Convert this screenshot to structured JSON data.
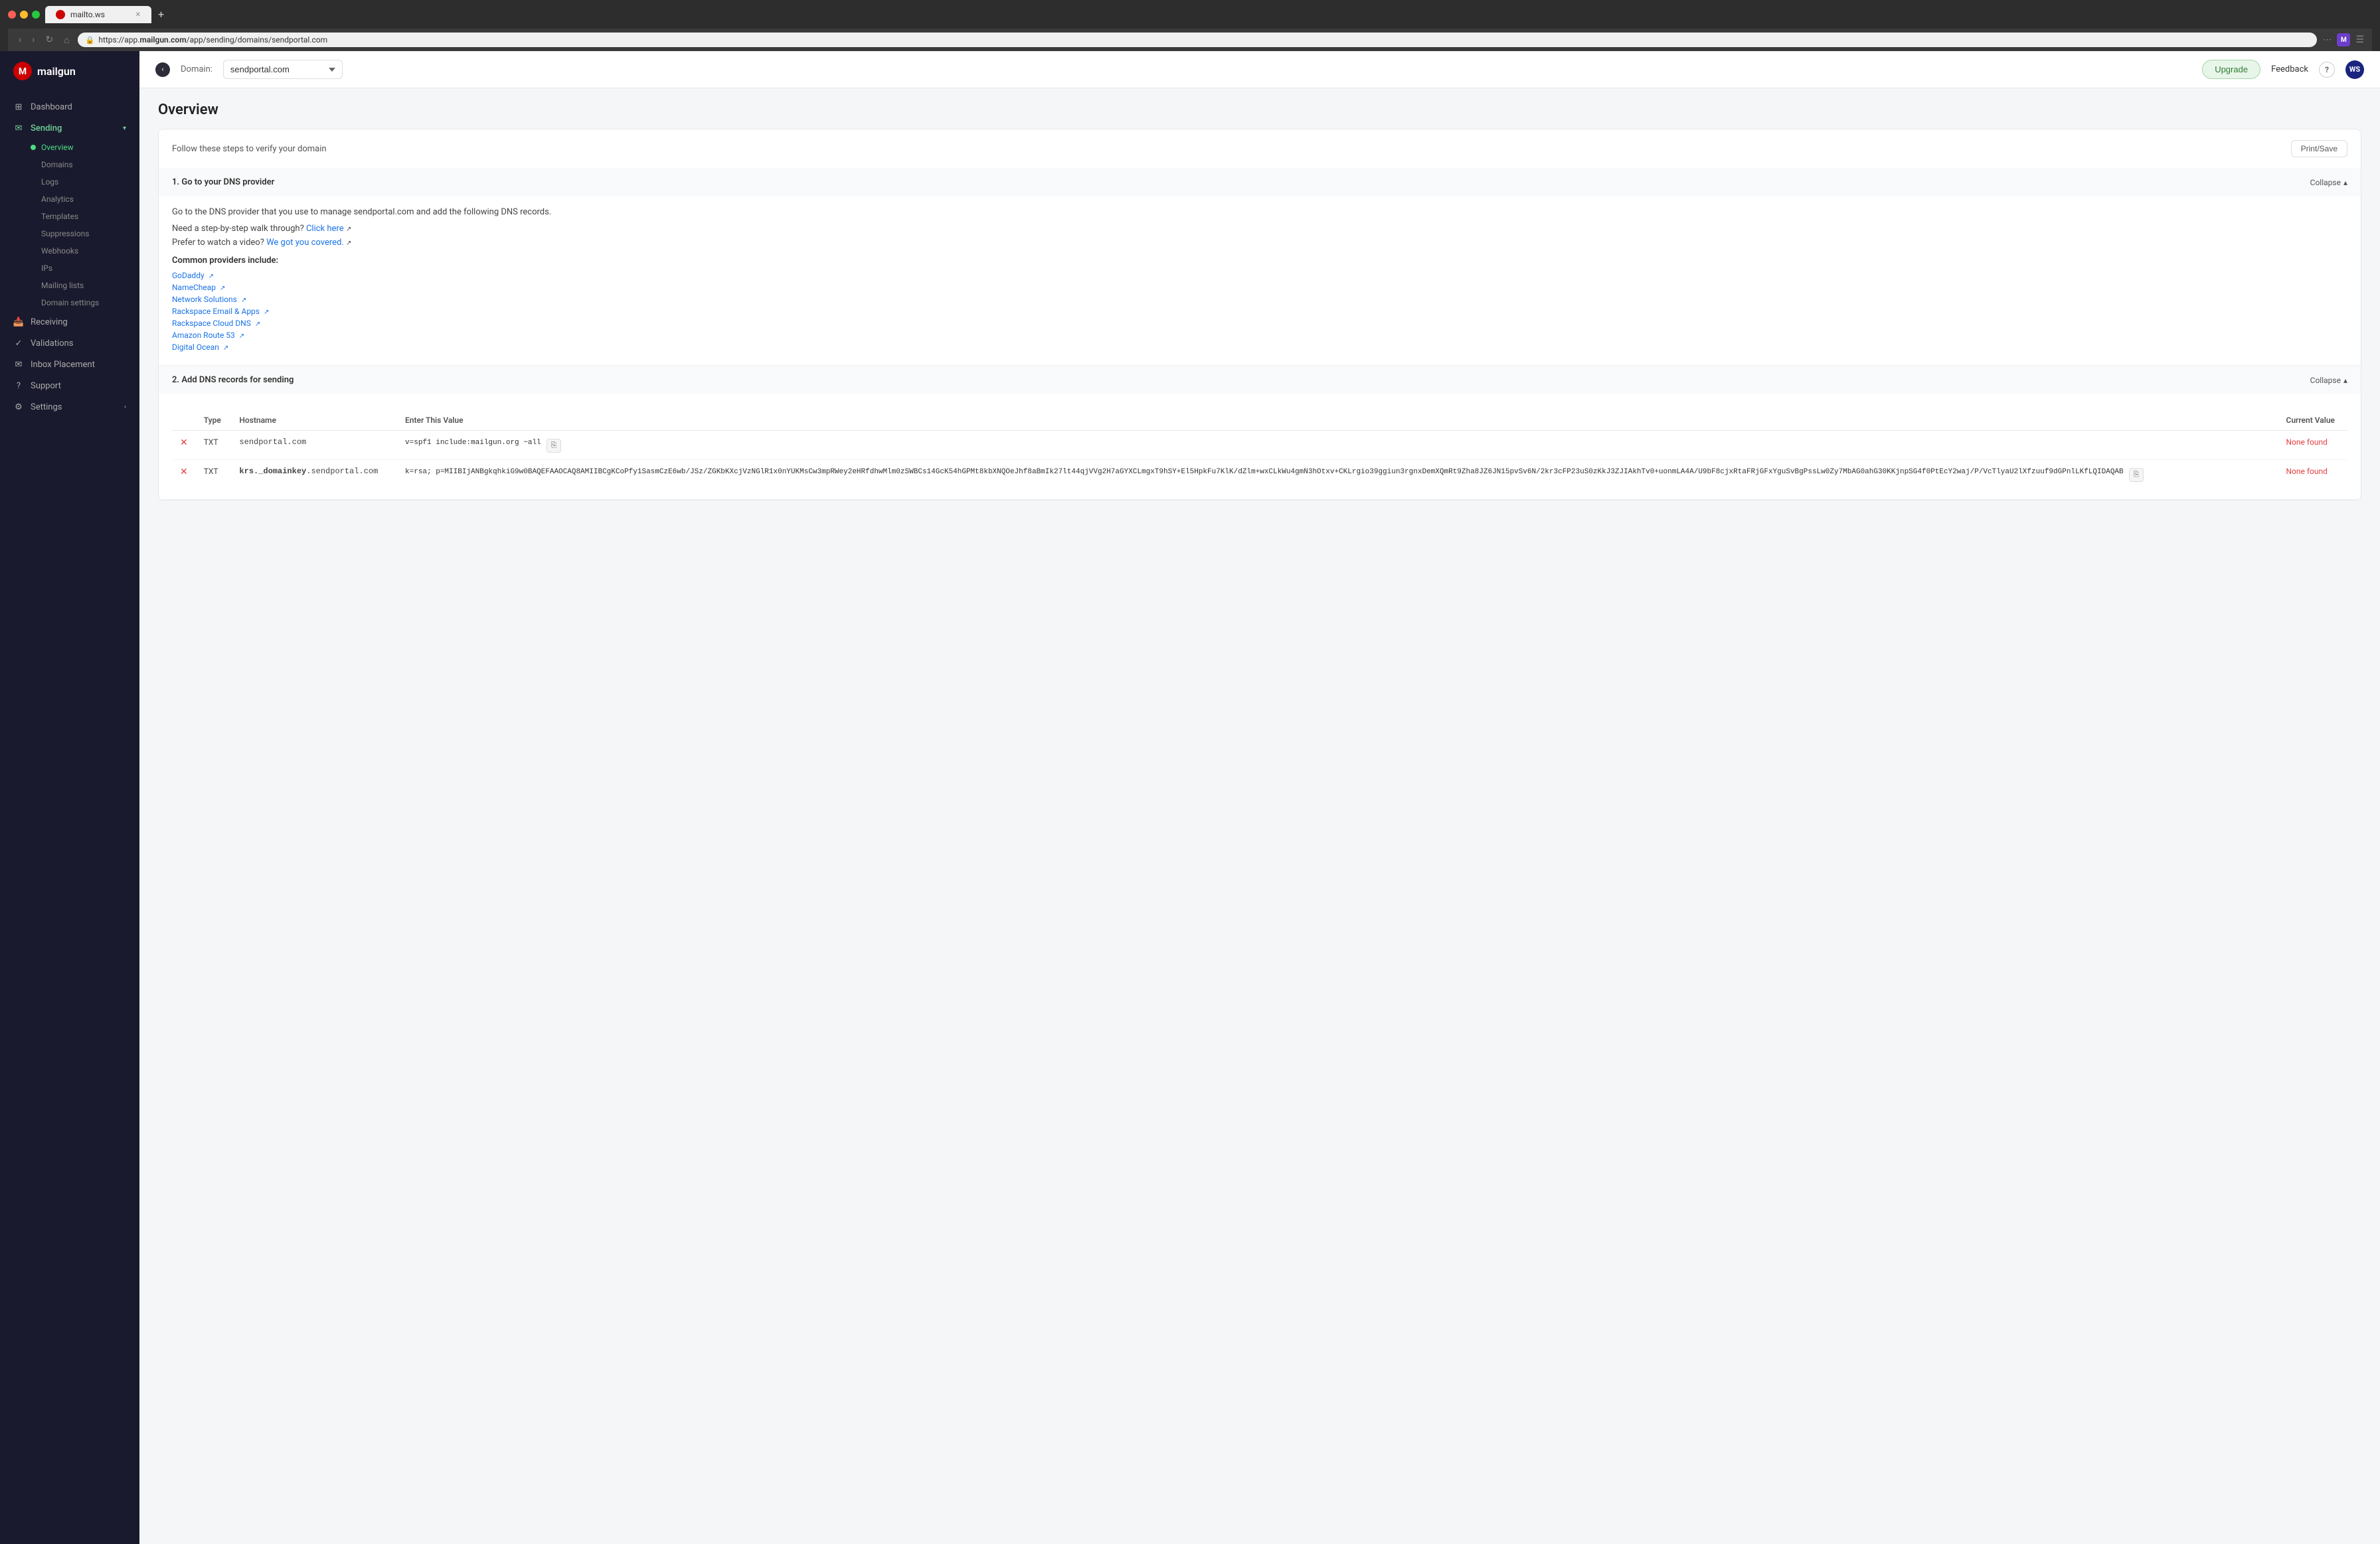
{
  "browser": {
    "tab_title": "mailto.ws",
    "url": "https://app.mailgun.com/app/sending/domains/sendportal.com",
    "url_domain_bold": "mailgun.com",
    "url_path": "/app/sending/domains/sendportal.com"
  },
  "header": {
    "domain_label": "Domain:",
    "domain_value": "sendportal.com",
    "upgrade_label": "Upgrade",
    "feedback_label": "Feedback",
    "help_label": "?",
    "avatar_label": "WS"
  },
  "sidebar": {
    "logo_text": "mailgun",
    "items": [
      {
        "id": "dashboard",
        "label": "Dashboard",
        "icon": "grid"
      },
      {
        "id": "sending",
        "label": "Sending",
        "icon": "send",
        "expanded": true
      },
      {
        "id": "overview",
        "label": "Overview",
        "sub": true,
        "active": true
      },
      {
        "id": "domains",
        "label": "Domains",
        "sub": true
      },
      {
        "id": "logs",
        "label": "Logs",
        "sub": true
      },
      {
        "id": "analytics",
        "label": "Analytics",
        "sub": true
      },
      {
        "id": "templates",
        "label": "Templates",
        "sub": true
      },
      {
        "id": "suppressions",
        "label": "Suppressions",
        "sub": true
      },
      {
        "id": "webhooks",
        "label": "Webhooks",
        "sub": true
      },
      {
        "id": "ips",
        "label": "IPs",
        "sub": true
      },
      {
        "id": "mailing-lists",
        "label": "Mailing lists",
        "sub": true
      },
      {
        "id": "domain-settings",
        "label": "Domain settings",
        "sub": true
      },
      {
        "id": "receiving",
        "label": "Receiving",
        "icon": "inbox"
      },
      {
        "id": "validations",
        "label": "Validations",
        "icon": "check"
      },
      {
        "id": "inbox-placement",
        "label": "Inbox Placement",
        "icon": "mail"
      },
      {
        "id": "support",
        "label": "Support",
        "icon": "help"
      },
      {
        "id": "settings",
        "label": "Settings",
        "icon": "gear",
        "has_arrow": true
      }
    ]
  },
  "page": {
    "title": "Overview"
  },
  "content": {
    "follow_text": "Follow these steps to verify your domain",
    "print_save_label": "Print/Save",
    "step1": {
      "title": "1. Go to your DNS provider",
      "collapse_label": "Collapse",
      "desc": "Go to the DNS provider that you use to manage sendportal.com and add the following DNS records.",
      "step_link_text": "Need a step-by-step walk through?",
      "step_link_anchor": "Click here",
      "video_text": "Prefer to watch a video?",
      "video_link": "We got you covered.",
      "providers_label": "Common providers include:",
      "providers": [
        {
          "name": "GoDaddy"
        },
        {
          "name": "NameCheap"
        },
        {
          "name": "Network Solutions"
        },
        {
          "name": "Rackspace Email & Apps"
        },
        {
          "name": "Rackspace Cloud DNS"
        },
        {
          "name": "Amazon Route 53"
        },
        {
          "name": "Digital Ocean"
        }
      ]
    },
    "step2": {
      "title": "2. Add DNS records for sending",
      "collapse_label": "Collapse",
      "columns": [
        "Type",
        "Hostname",
        "Enter This Value",
        "Current Value"
      ],
      "rows": [
        {
          "type": "TXT",
          "hostname": "sendportal.com",
          "value": "v=spf1 include:mailgun.org ~all",
          "current": "None found",
          "error": true
        },
        {
          "type": "TXT",
          "hostname_prefix": "krs._domainkey",
          "hostname_suffix": ".sendportal.com",
          "value": "k=rsa; p=MIIBIjANBgkqhkiG9w0BAQEFAAOCAQ8AMIIBCgKCoPfy1SasmCzE6wb/JSz/ZGKbKXcjVzNGlR1x0nYUKMsCw3mpRWey2eHRfdhwMlm0zSWBCs14GcK54hGPMt8kbXNQOeJhf8aBmIk27lt44qjVVg2H7aGYXCLmgxT9hSY+El5HpkFu7KlK/dZlm+wxCLkWu4gmN3hOtxv+CKLrgio39ggiun3rgnxDemXQmRt9Zha8JZ6JN15pvSv6N/2kr3cFP23uS0zKkJ3ZJIAkhTv0+uonmLA4A/U9bF8cjxRtaFRjGFxYguSvBgPssLw0Zy7MbAG0ahG30KKjnpSG4f0PtEcY2waj/P/VcTlyaU2lXfzuuf9dGPnlLKfLQIDAQAB",
          "current": "None found",
          "error": true
        }
      ]
    }
  }
}
